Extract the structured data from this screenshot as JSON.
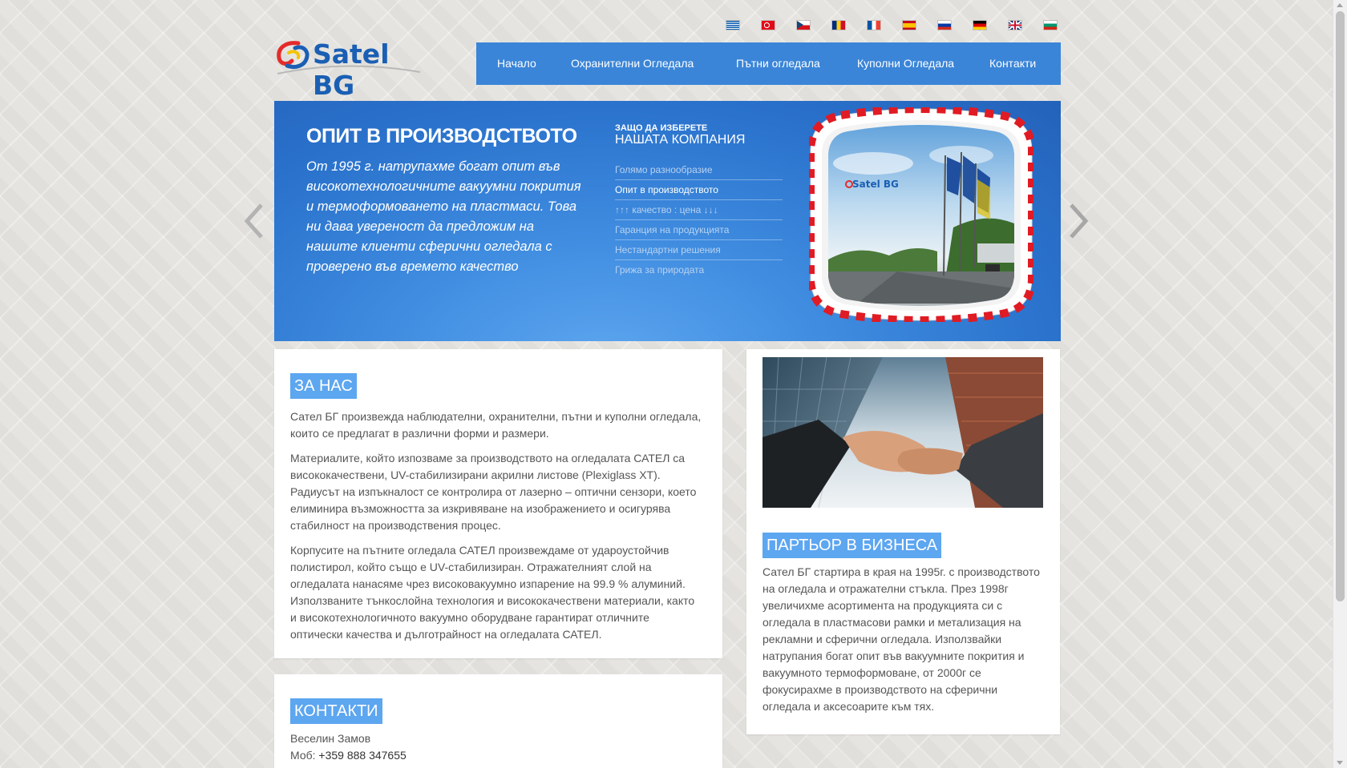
{
  "flags": [
    {
      "name": "greece-flag",
      "lang": "el"
    },
    {
      "name": "turkey-flag",
      "lang": "tr"
    },
    {
      "name": "czech-flag",
      "lang": "cs"
    },
    {
      "name": "romania-flag",
      "lang": "ro"
    },
    {
      "name": "france-flag",
      "lang": "fr"
    },
    {
      "name": "spain-flag",
      "lang": "es"
    },
    {
      "name": "russia-flag",
      "lang": "ru"
    },
    {
      "name": "germany-flag",
      "lang": "de"
    },
    {
      "name": "uk-flag",
      "lang": "en"
    },
    {
      "name": "bulgaria-flag",
      "lang": "bg"
    }
  ],
  "logo": {
    "text": "Satel BG"
  },
  "nav": {
    "items": [
      "Начало",
      "Охранителни Огледала",
      "Пътни огледала",
      "Куполни Огледала",
      "Контакти"
    ]
  },
  "hero": {
    "title": "ОПИТ В ПРОИЗВОДСТВОТО",
    "text": "От 1995 г. натрупахме богат опит във високотехнологичните вакуумни покрития и термоформоването на пластмаси. Това ни дава увереност да предложим на нашите клиенти сферични огледала с проверено във времето качество",
    "why_small": "ЗАЩО ДА ИЗБЕРЕТЕ",
    "why_big": "НАШАТА КОМПАНИЯ",
    "reasons": [
      "Голямо разнообразие",
      "Опит в производството",
      "↑↑↑ качество : цена ↓↓↓",
      "Гаранция на продукцията",
      "Нестандартни решения",
      "Грижа за природата"
    ],
    "active_reason": 1,
    "mirror_logo": "Satel BG"
  },
  "about": {
    "heading": "ЗА НАС",
    "paragraphs": [
      "Сател БГ произвежда наблюдателни, охранителни, пътни и куполни огледала, които се предлагат в различни форми и размери.",
      "Материалите, който изпозваме за производството на огледалата САТЕЛ са висококачествени, UV-стабилизирани акрилни листове (Plexiglass XT). Радиусът на изпъкналост се контролира от лазерно – оптични сензори, което елиминира възможността за изкривяване на изображението и осигурява стабилност на производствения процес.",
      "Корпусите на пътните огледала САТЕЛ произвеждаме от удароустойчив полистирол, който също е UV-стабилизиран. Отражателният слой на огледалата нанасяме чрез високовакуумно изпарение на 99.9 % алуминий. Използваните тънкослойна технология и висококачествени материали, както и високотехнологичното вакуумно оборудване гарантират отличните оптически качества и дълготрайност на огледалата САТЕЛ."
    ]
  },
  "partner": {
    "heading": "ПАРТЬОР В БИЗНЕСА",
    "text": "Сател БГ стартира в края на 1995г. с производството на огледала и отражателни стъкла. През 1998г увеличихме асортимента на продукцията си с огледала в пластмасови рамки и метализация на рекламни и сферични огледала. Използвайки натрупания богат опит във вакуумните покрития и вакуумното термоформоване, от 2000г се фокусирахме в производството на сферични огледала и аксесоарите към тях."
  },
  "contacts": {
    "heading": "КОНТАКТИ",
    "name": "Веселин Замов",
    "phone_label": "Моб: ",
    "phone": "+359 888 347655"
  }
}
